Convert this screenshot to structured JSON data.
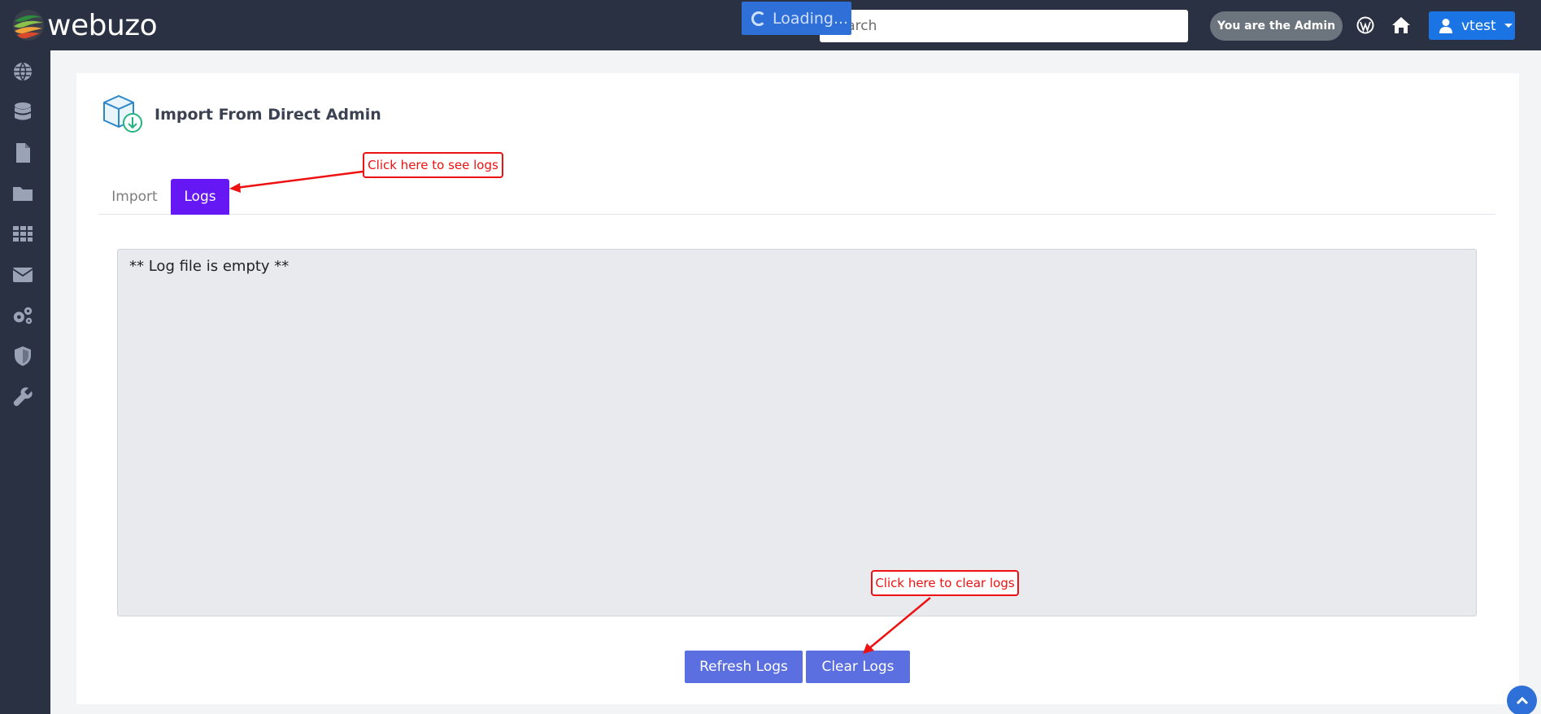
{
  "app": {
    "brand": "webuzo"
  },
  "header": {
    "loading_text": "Loading...",
    "search_placeholder": "Search",
    "admin_badge": "You are the Admin",
    "user_name": "vtest",
    "icons": [
      "wordpress-icon",
      "home-icon",
      "user-icon"
    ]
  },
  "sidebar": {
    "items": [
      {
        "icon": "globe-icon"
      },
      {
        "icon": "database-icon"
      },
      {
        "icon": "file-icon"
      },
      {
        "icon": "folder-icon"
      },
      {
        "icon": "apps-grid-icon"
      },
      {
        "icon": "envelope-icon"
      },
      {
        "icon": "gears-icon"
      },
      {
        "icon": "shield-icon"
      },
      {
        "icon": "wrench-icon"
      }
    ]
  },
  "page": {
    "title": "Import From Direct Admin",
    "tabs": [
      {
        "label": "Import",
        "active": false
      },
      {
        "label": "Logs",
        "active": true
      }
    ],
    "log_text": "** Log file is empty **",
    "buttons": {
      "refresh": "Refresh Logs",
      "clear": "Clear Logs"
    }
  },
  "annotations": {
    "logs_callout": "Click here to see logs",
    "clear_callout": "Click here to clear logs"
  },
  "colors": {
    "topbar": "#2a3142",
    "active_tab": "#6518f4",
    "button": "#5b6fe0",
    "user_button": "#1b74e4",
    "annotation": "#e11111"
  }
}
